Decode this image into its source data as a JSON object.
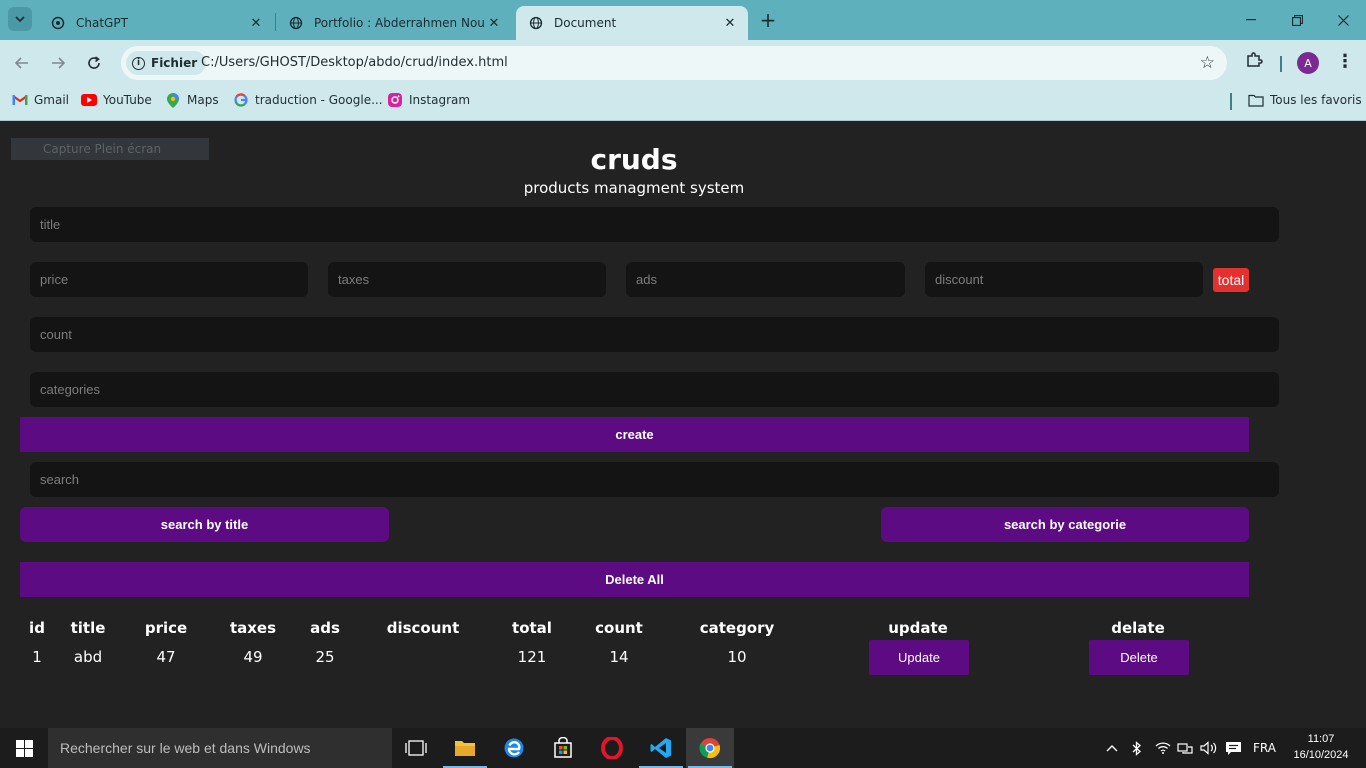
{
  "browser": {
    "tabs": [
      {
        "title": "ChatGPT",
        "icon": "chatgpt-icon",
        "close": "✕",
        "active": false
      },
      {
        "title": "Portfolio : Abderrahmen Nouali",
        "icon": "globe-icon",
        "close": "✕",
        "active": false
      },
      {
        "title": "Document",
        "icon": "globe-icon",
        "close": "✕",
        "active": true
      }
    ],
    "new_tab": "+",
    "address": {
      "chip": "Fichier",
      "url": "C:/Users/GHOST/Desktop/abdo/crud/index.html"
    },
    "profile_initial": "A",
    "bookmarks": [
      {
        "label": "Gmail",
        "icon": "gmail-icon"
      },
      {
        "label": "YouTube",
        "icon": "youtube-icon"
      },
      {
        "label": "Maps",
        "icon": "maps-icon"
      },
      {
        "label": "traduction - Google...",
        "icon": "google-icon"
      },
      {
        "label": "Instagram",
        "icon": "instagram-icon"
      }
    ],
    "all_bookmarks": "Tous les favoris"
  },
  "page": {
    "capture_label": "Capture Plein écran",
    "title": "cruds",
    "subtitle": "products managment system",
    "placeholders": {
      "title": "title",
      "price": "price",
      "taxes": "taxes",
      "ads": "ads",
      "discount": "discount",
      "count": "count",
      "categories": "categories",
      "search": "search"
    },
    "total_label": "total",
    "buttons": {
      "create": "create",
      "search_title": "search by title",
      "search_category": "search by categorie",
      "delete_all": "Delete All"
    },
    "table": {
      "headers": [
        "id",
        "title",
        "price",
        "taxes",
        "ads",
        "discount",
        "total",
        "count",
        "category",
        "update",
        "delate"
      ],
      "rows": [
        {
          "id": "1",
          "title": "abd",
          "price": "47",
          "taxes": "49",
          "ads": "25",
          "discount": "",
          "total": "121",
          "count": "14",
          "category": "10",
          "update": "Update",
          "delete": "Delete"
        }
      ]
    },
    "colors": {
      "accent": "#5c0b82",
      "total_badge": "#e53030",
      "background": "#222222",
      "input_bg": "#141414"
    }
  },
  "taskbar": {
    "search_placeholder": "Rechercher sur le web et dans Windows",
    "language": "FRA",
    "time": "11:07",
    "date": "16/10/2024"
  }
}
